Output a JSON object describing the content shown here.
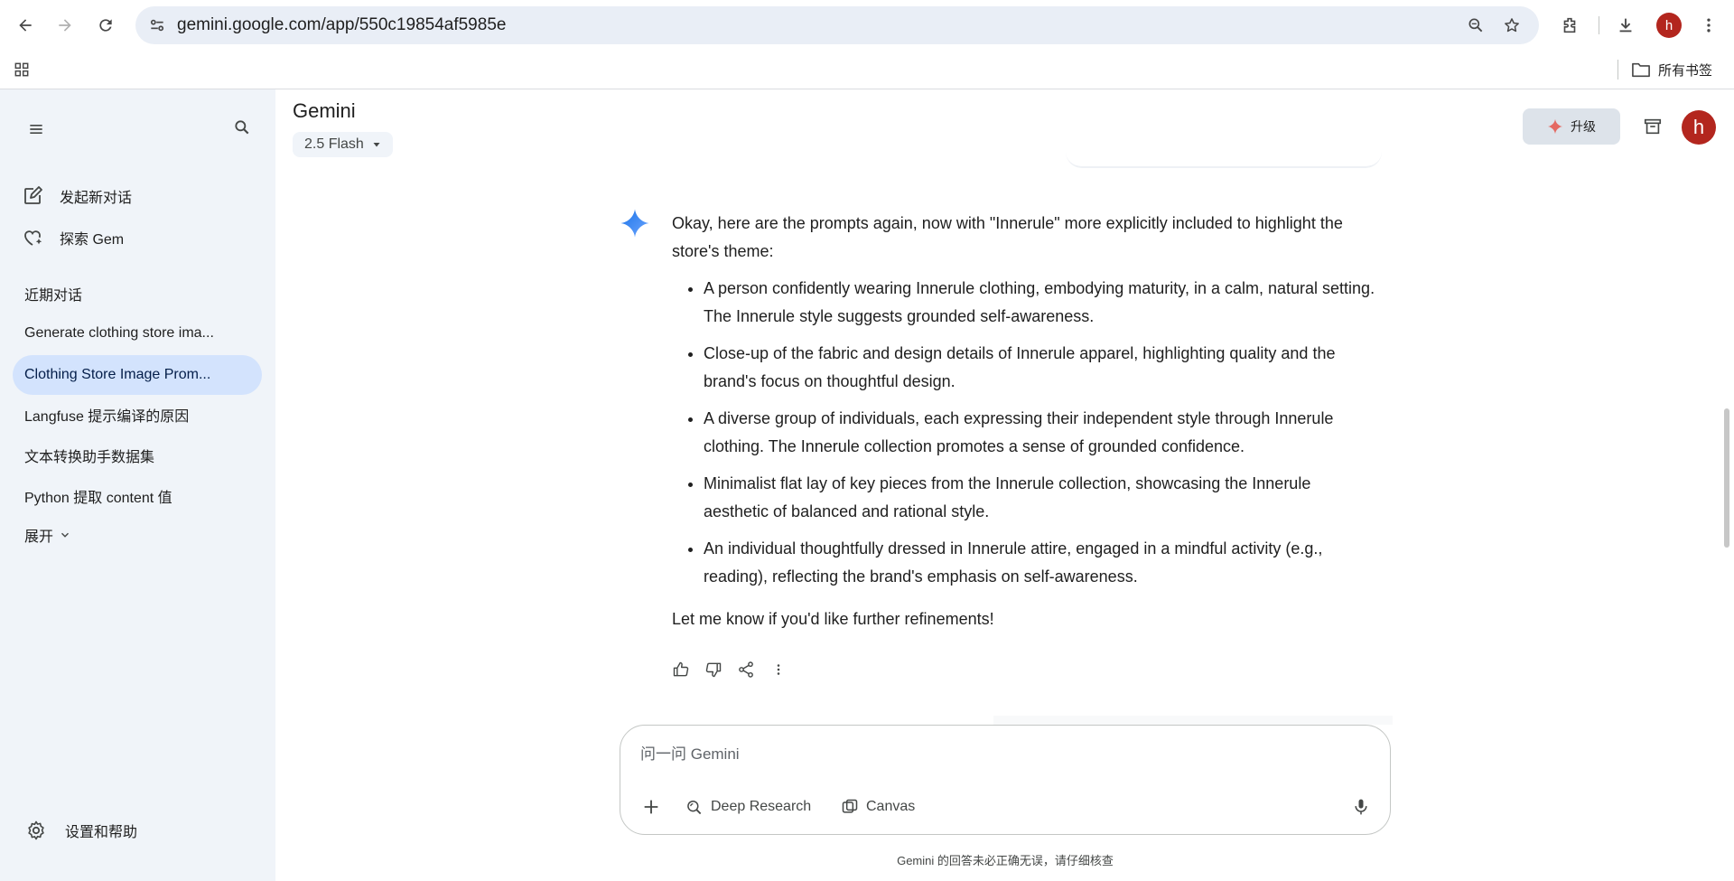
{
  "browser": {
    "url": "gemini.google.com/app/550c19854af5985e",
    "profile_initial": "h",
    "all_bookmarks_label": "所有书签"
  },
  "app": {
    "title": "Gemini",
    "model": "2.5 Flash",
    "upgrade_label": "升级",
    "account_initial": "h"
  },
  "sidebar": {
    "new_chat": "发起新对话",
    "explore_gem": "探索 Gem",
    "recent_heading": "近期对话",
    "recent": [
      {
        "label": "Generate clothing store ima..."
      },
      {
        "label": "Clothing Store Image Prom..."
      },
      {
        "label": "Langfuse 提示编译的原因"
      },
      {
        "label": "文本转换助手数据集"
      },
      {
        "label": "Python 提取 content 值"
      }
    ],
    "expand": "展开",
    "settings": "设置和帮助"
  },
  "response": {
    "intro": "Okay, here are the prompts again, now with \"Innerule\" more explicitly included to highlight the store's theme:",
    "bullets": [
      "A person confidently wearing Innerule clothing, embodying maturity, in a calm, natural setting. The Innerule style suggests grounded self-awareness.",
      "Close-up of the fabric and design details of Innerule apparel, highlighting quality and the brand's focus on thoughtful design.",
      "A diverse group of individuals, each expressing their independent style through Innerule clothing. The Innerule collection promotes a sense of grounded confidence.",
      "Minimalist flat lay of key pieces from the Innerule collection, showcasing the Innerule aesthetic of balanced and rational style.",
      "An individual thoughtfully dressed in Innerule attire, engaged in a mindful activity (e.g., reading), reflecting the brand's emphasis on self-awareness."
    ],
    "outro": "Let me know if you'd like further refinements!"
  },
  "input": {
    "placeholder": "问一问 Gemini",
    "value": "",
    "deep_research": "Deep Research",
    "canvas": "Canvas"
  },
  "disclaimer": "Gemini 的回答未必正确无误，请仔细核查",
  "colors": {
    "sidebar_bg": "#f0f4f9",
    "active_item_bg": "#d3e3fd",
    "avatar_red": "#b3261e",
    "spark_blue": "#4285f4"
  }
}
